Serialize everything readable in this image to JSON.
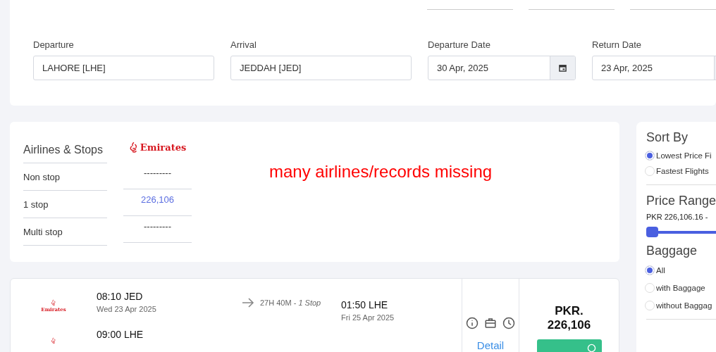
{
  "search": {
    "fields": [
      {
        "label": "Departure",
        "value": "LAHORE [LHE]",
        "kind": "text"
      },
      {
        "label": "Arrival",
        "value": "JEDDAH [JED]",
        "kind": "text"
      },
      {
        "label": "Departure Date",
        "value": "30 Apr, 2025",
        "kind": "date"
      },
      {
        "label": "Return Date",
        "value": "23 Apr, 2025",
        "kind": "date"
      }
    ]
  },
  "matrix": {
    "title": "Airlines & Stops",
    "airline": "Emirates",
    "rows": [
      {
        "label": "Non stop",
        "value": "---------",
        "available": false
      },
      {
        "label": "1 stop",
        "value": "226,106",
        "available": true
      },
      {
        "label": "Multi stop",
        "value": "---------",
        "available": false
      }
    ],
    "note": "many airlines/records missing"
  },
  "filters": {
    "sort": {
      "title": "Sort By",
      "options": [
        {
          "label": "Lowest Price Fi",
          "selected": true
        },
        {
          "label": "Fastest Flights",
          "selected": false
        }
      ]
    },
    "price": {
      "title": "Price Range",
      "range": "PKR 226,106.16 -",
      "level": 0
    },
    "baggage": {
      "title": "Baggage",
      "options": [
        {
          "label": "All",
          "selected": true
        },
        {
          "label": "with Baggage",
          "selected": false
        },
        {
          "label": "without Baggag",
          "selected": false
        }
      ]
    }
  },
  "results": [
    {
      "airline": "Emirates",
      "legs": [
        {
          "depart_time": "08:10 JED",
          "depart_date": "Wed 23 Apr 2025",
          "duration": "27H 40M - *1 Stop*",
          "arrive_time": "01:50 LHE",
          "arrive_date": "Fri 25 Apr 2025"
        },
        {
          "depart_time": "09:00 LHE"
        }
      ],
      "price": "PKR. 226,106",
      "detail": "Detail"
    }
  ]
}
